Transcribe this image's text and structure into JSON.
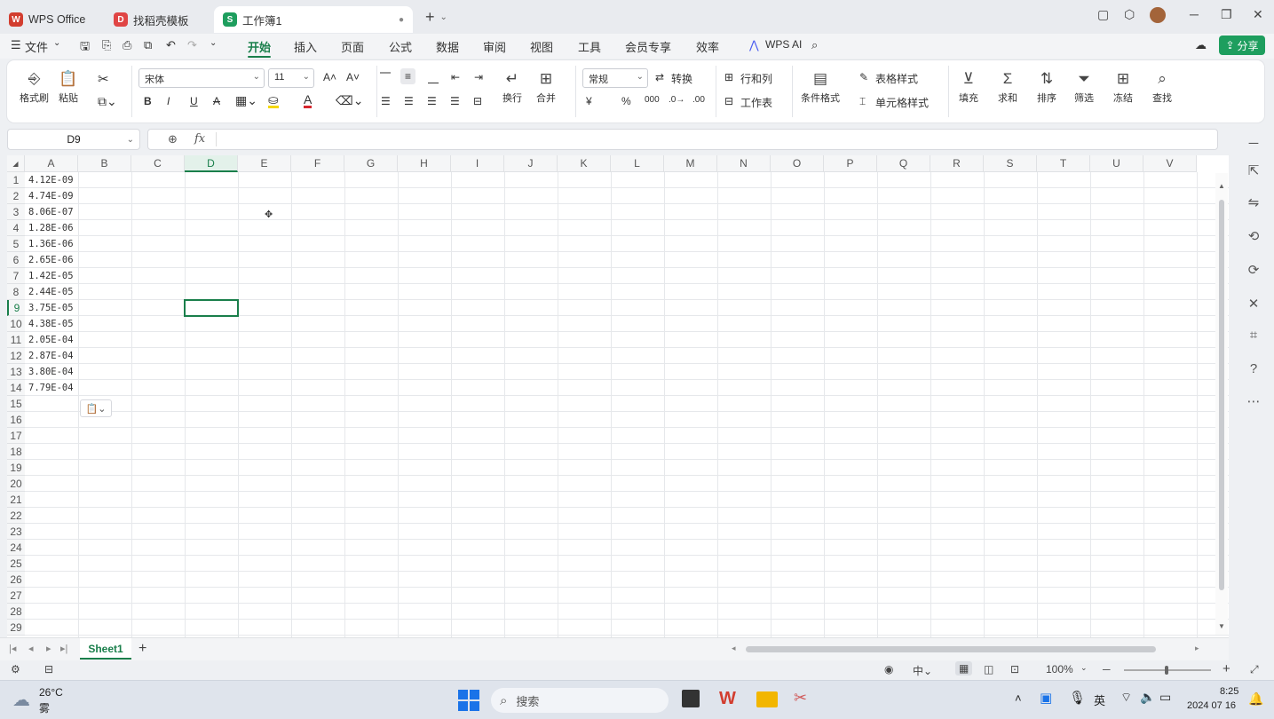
{
  "titlebar": {
    "tabs": [
      {
        "label": "WPS Office",
        "icon": "wps-logo-icon",
        "color": "#d23d2f"
      },
      {
        "label": "找稻壳模板",
        "icon": "docer-logo-icon",
        "color": "#e04545"
      },
      {
        "label": "工作簿1",
        "icon": "sheet-logo-icon",
        "color": "#1e9e5e"
      }
    ],
    "new_tab": "+"
  },
  "menu": {
    "file": "文件",
    "tabs": [
      "开始",
      "插入",
      "页面",
      "公式",
      "数据",
      "审阅",
      "视图",
      "工具",
      "会员专享",
      "效率"
    ],
    "active_tab": "开始",
    "ai": "WPS AI",
    "share": "分享"
  },
  "ribbon": {
    "format_painter": "格式刷",
    "paste": "粘贴",
    "font_name": "宋体",
    "font_size": "11",
    "wrap": "换行",
    "merge": "合并",
    "number_format": "常规",
    "convert": "转换",
    "rows_cols": "行和列",
    "worksheet": "工作表",
    "cond_format": "条件格式",
    "table_style": "表格样式",
    "cell_style": "单元格样式",
    "fill": "填充",
    "sum": "求和",
    "sort": "排序",
    "filter": "筛选",
    "freeze": "冻结",
    "find": "查找",
    "bold": "B",
    "italic": "I",
    "underline": "U",
    "strike": "A",
    "currency": "¥",
    "percent": "%"
  },
  "formula_bar": {
    "name_box": "D9",
    "fx": "fx",
    "value": ""
  },
  "grid": {
    "columns": [
      "A",
      "B",
      "C",
      "D",
      "E",
      "F",
      "G",
      "H",
      "I",
      "J",
      "K",
      "L",
      "M",
      "N",
      "O",
      "P",
      "Q",
      "R",
      "S",
      "T",
      "U",
      "V"
    ],
    "rows": [
      "1",
      "2",
      "3",
      "4",
      "5",
      "6",
      "7",
      "8",
      "9",
      "10",
      "11",
      "12",
      "13",
      "14",
      "15",
      "16",
      "17",
      "18",
      "19",
      "20",
      "21",
      "22",
      "23",
      "24",
      "25",
      "26",
      "27",
      "28",
      "29"
    ],
    "col_a_values": [
      "4.12E-09",
      "4.74E-09",
      "8.06E-07",
      "1.28E-06",
      "1.36E-06",
      "2.65E-06",
      "1.42E-05",
      "2.44E-05",
      "3.75E-05",
      "4.38E-05",
      "2.05E-04",
      "2.87E-04",
      "3.80E-04",
      "7.79E-04"
    ],
    "active_cell": "D9",
    "active_col": "D",
    "active_row": "9"
  },
  "sheets": {
    "tabs": [
      "Sheet1"
    ],
    "add": "+"
  },
  "status": {
    "zoom": "100%"
  },
  "taskbar": {
    "weather_temp": "26°C",
    "weather_desc": "雾",
    "search": "搜索",
    "ime": "英",
    "time": "8:25",
    "date": "2024 07 16"
  }
}
